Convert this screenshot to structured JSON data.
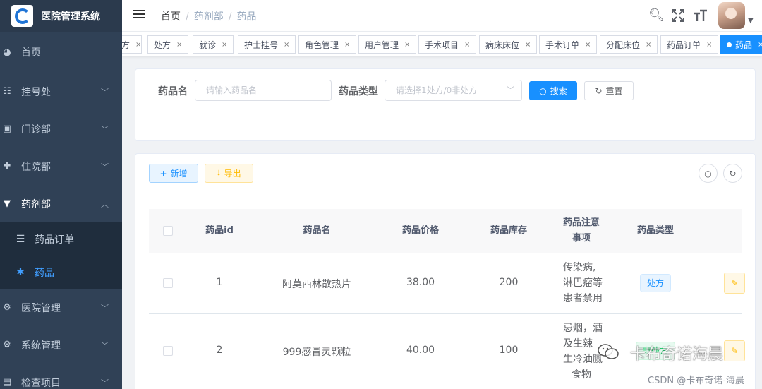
{
  "app": {
    "title": "医院管理系统"
  },
  "sidebar": {
    "items": [
      {
        "label": "首页",
        "icon": "dashboard-icon",
        "glyph": "◕",
        "expandable": false
      },
      {
        "label": "挂号处",
        "icon": "registration-icon",
        "glyph": "☷",
        "expandable": true
      },
      {
        "label": "门诊部",
        "icon": "outpatient-icon",
        "glyph": "▣",
        "expandable": true
      },
      {
        "label": "住院部",
        "icon": "inpatient-icon",
        "glyph": "✚",
        "expandable": true
      },
      {
        "label": "药剂部",
        "icon": "cart-icon",
        "glyph": "🛒",
        "expandable": true,
        "open": true
      },
      {
        "label": "医院管理",
        "icon": "gear-icon",
        "glyph": "⚙",
        "expandable": true
      },
      {
        "label": "系统管理",
        "icon": "gear-icon",
        "glyph": "⚙",
        "expandable": true
      },
      {
        "label": "检查项目",
        "icon": "checkup-icon",
        "glyph": "▤",
        "expandable": true
      }
    ],
    "submenu": [
      {
        "label": "药品订单",
        "icon": "list-icon",
        "glyph": "☰",
        "active": false
      },
      {
        "label": "药品",
        "icon": "bug-icon",
        "glyph": "✱",
        "active": true
      }
    ]
  },
  "navbar": {
    "breadcrumb": [
      "首页",
      "药剂部",
      "药品"
    ]
  },
  "tags": [
    {
      "label": "方",
      "active": false
    },
    {
      "label": "处方",
      "active": false
    },
    {
      "label": "就诊",
      "active": false
    },
    {
      "label": "护士挂号",
      "active": false
    },
    {
      "label": "角色管理",
      "active": false
    },
    {
      "label": "用户管理",
      "active": false
    },
    {
      "label": "手术项目",
      "active": false
    },
    {
      "label": "病床床位",
      "active": false
    },
    {
      "label": "手术订单",
      "active": false
    },
    {
      "label": "分配床位",
      "active": false
    },
    {
      "label": "药品订单",
      "active": false
    },
    {
      "label": "药品",
      "active": true
    }
  ],
  "search": {
    "name_label": "药品名",
    "name_placeholder": "请输入药品名",
    "type_label": "药品类型",
    "type_placeholder": "请选择1处方/0非处方",
    "search_button": "搜索",
    "reset_button": "重置"
  },
  "toolbar": {
    "add_button": "新增",
    "export_button": "导出"
  },
  "table": {
    "headers": [
      "药品id",
      "药品名",
      "药品价格",
      "药品库存",
      "药品注意事项",
      "药品类型"
    ],
    "header_note_lines": [
      "药品注意",
      "事项"
    ],
    "rows": [
      {
        "id": "1",
        "name": "阿莫西林散热片",
        "price": "38.00",
        "stock": "200",
        "note_lines": [
          "传染病,",
          "淋巴瘤等",
          "患者禁用"
        ],
        "type": "处方"
      },
      {
        "id": "2",
        "name": "999感冒灵颗粒",
        "price": "40.00",
        "stock": "100",
        "note_lines": [
          "忌烟，酒",
          "及生辣",
          "生冷油腻",
          "食物"
        ],
        "type": "非处方"
      }
    ]
  },
  "watermark": {
    "main": "卡布奇诺海晨",
    "csdn": "CSDN @卡布奇诺-海晨"
  },
  "colors": {
    "sidebar_bg": "#304156",
    "submenu_bg": "#1f2d3d",
    "primary": "#1890ff",
    "warning": "#ffba00",
    "success": "#13ce66"
  }
}
